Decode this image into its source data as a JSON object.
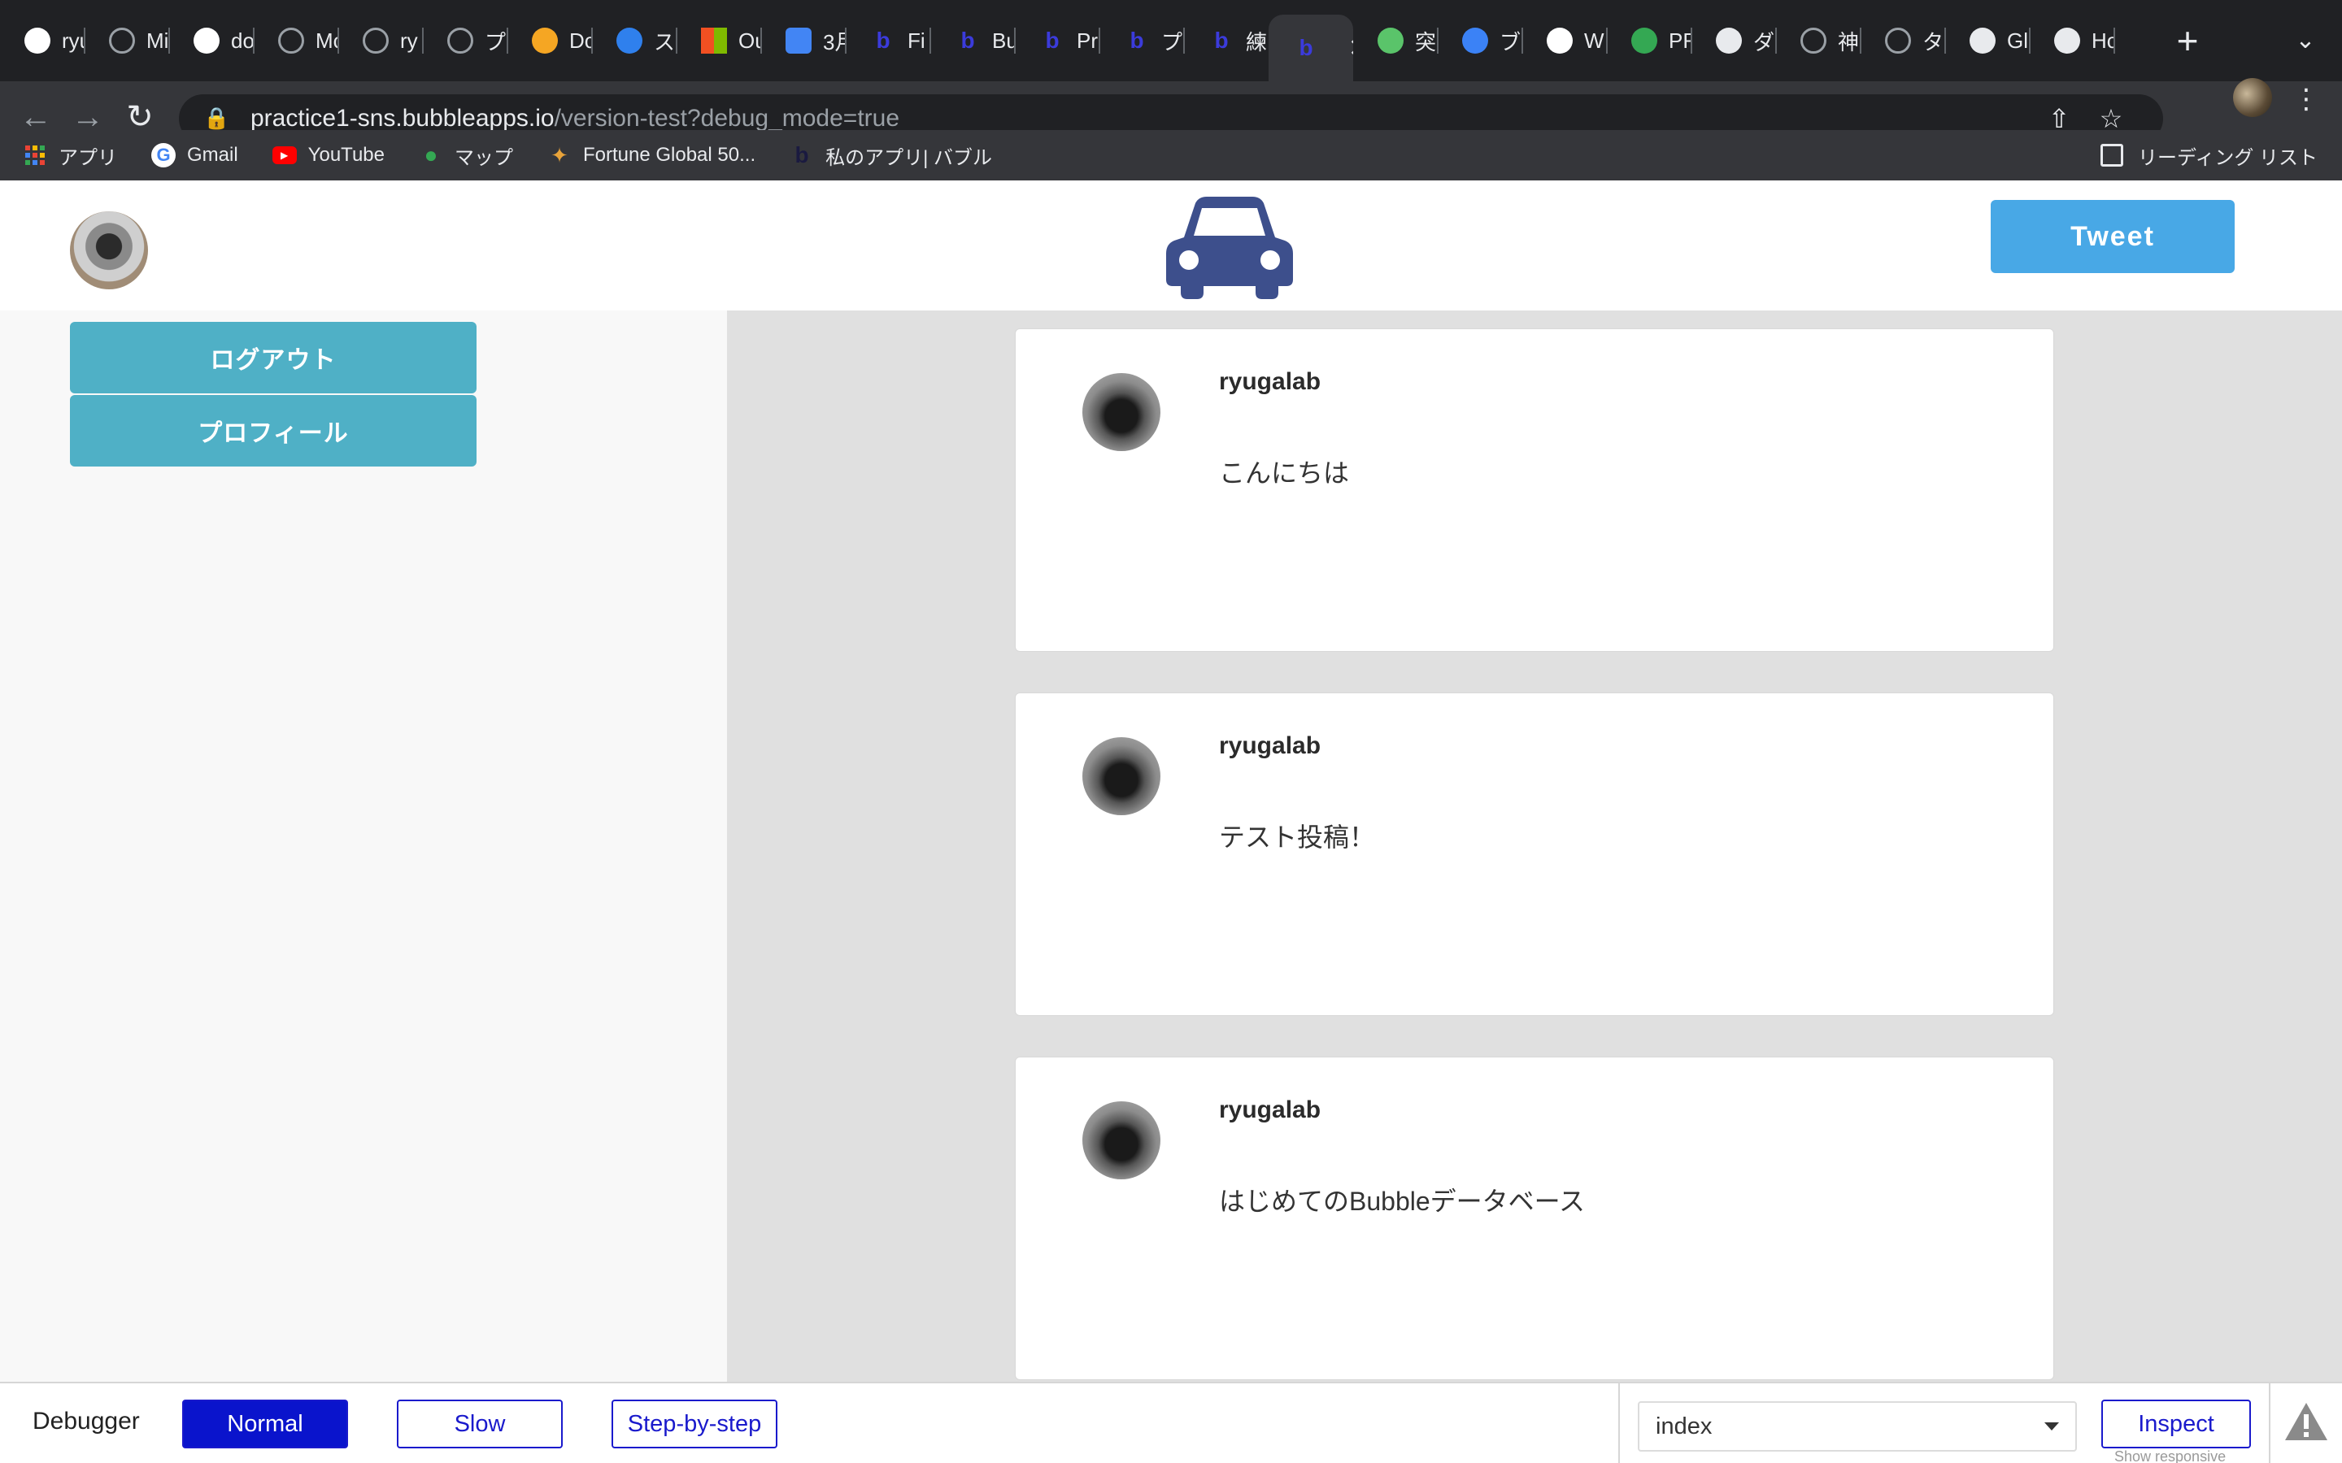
{
  "browser": {
    "tabs": [
      {
        "title": "ryu",
        "icon": "github-icon",
        "color": "#ffffff"
      },
      {
        "title": "Mi",
        "icon": "globe-icon",
        "color": "#9aa0a6"
      },
      {
        "title": "do",
        "icon": "docker-icon",
        "color": "#ffffff"
      },
      {
        "title": "Mc",
        "icon": "globe-icon",
        "color": "#9aa0a6"
      },
      {
        "title": "ry",
        "icon": "globe-icon",
        "color": "#9aa0a6"
      },
      {
        "title": "プ",
        "icon": "globe-icon",
        "color": "#9aa0a6"
      },
      {
        "title": "Dc",
        "icon": "figma-icon",
        "color": "#f5a623"
      },
      {
        "title": "ス",
        "icon": "vscode-icon",
        "color": "#2f80ed"
      },
      {
        "title": "Ou",
        "icon": "microsoft-icon",
        "color": "#f25022"
      },
      {
        "title": "3月",
        "icon": "docs-icon",
        "color": "#4285f4"
      },
      {
        "title": "Fi",
        "icon": "bubble-icon",
        "color": "#3b3bdb"
      },
      {
        "title": "Bu",
        "icon": "bubble-icon",
        "color": "#3b3bdb"
      },
      {
        "title": "Pr",
        "icon": "bubble-icon",
        "color": "#3b3bdb"
      },
      {
        "title": "プ",
        "icon": "bubble-icon",
        "color": "#3b3bdb"
      },
      {
        "title": "練",
        "icon": "bubble-icon",
        "color": "#3b3bdb"
      },
      {
        "title": "",
        "icon": "bubble-icon",
        "color": "#3b3bdb",
        "active": true
      },
      {
        "title": "突",
        "icon": "green-logo-icon",
        "color": "#5ac46a"
      },
      {
        "title": "ブ",
        "icon": "canva-icon",
        "color": "#3b82f6"
      },
      {
        "title": "W",
        "icon": "w-logo-icon",
        "color": "#ffffff"
      },
      {
        "title": "PF",
        "icon": "drive-icon",
        "color": "#34a853"
      },
      {
        "title": "ダ",
        "icon": "download-icon",
        "color": "#e8eaed"
      },
      {
        "title": "神",
        "icon": "globe-icon",
        "color": "#9aa0a6"
      },
      {
        "title": "タ",
        "icon": "globe-icon",
        "color": "#9aa0a6"
      },
      {
        "title": "Gl",
        "icon": "bolt-icon",
        "color": "#e8eaed"
      },
      {
        "title": "Hc",
        "icon": "bolt-icon",
        "color": "#e8eaed"
      }
    ],
    "url_host": "practice1-sns.bubbleapps.io",
    "url_path": "/version-test?debug_mode=true",
    "bookmarks": [
      {
        "label": "アプリ",
        "icon": "apps-grid-icon"
      },
      {
        "label": "Gmail",
        "icon": "google-icon"
      },
      {
        "label": "YouTube",
        "icon": "youtube-icon"
      },
      {
        "label": "マップ",
        "icon": "maps-pin-icon"
      },
      {
        "label": "Fortune Global 50...",
        "icon": "fortune-icon"
      },
      {
        "label": "私のアプリ| バブル",
        "icon": "bubble-icon"
      }
    ],
    "reading_list": "リーディング リスト"
  },
  "app": {
    "tweet_button": "Tweet",
    "sidebar": {
      "logout": "ログアウト",
      "profile": "プロフィール"
    },
    "posts": [
      {
        "user": "ryugalab",
        "text": "こんにちは"
      },
      {
        "user": "ryugalab",
        "text": "テスト投稿！"
      },
      {
        "user": "ryugalab",
        "text": "はじめてのBubbleデータベース"
      }
    ],
    "colors": {
      "accent_tweet": "#48a8e6",
      "sidebar_button": "#4fb0c6",
      "logo": "#3d4f8c"
    }
  },
  "debugger": {
    "label": "Debugger",
    "modes": [
      "Normal",
      "Slow",
      "Step-by-step"
    ],
    "active_mode": "Normal",
    "page_select": "index",
    "inspect": "Inspect",
    "show_responsive": "Show responsive"
  }
}
